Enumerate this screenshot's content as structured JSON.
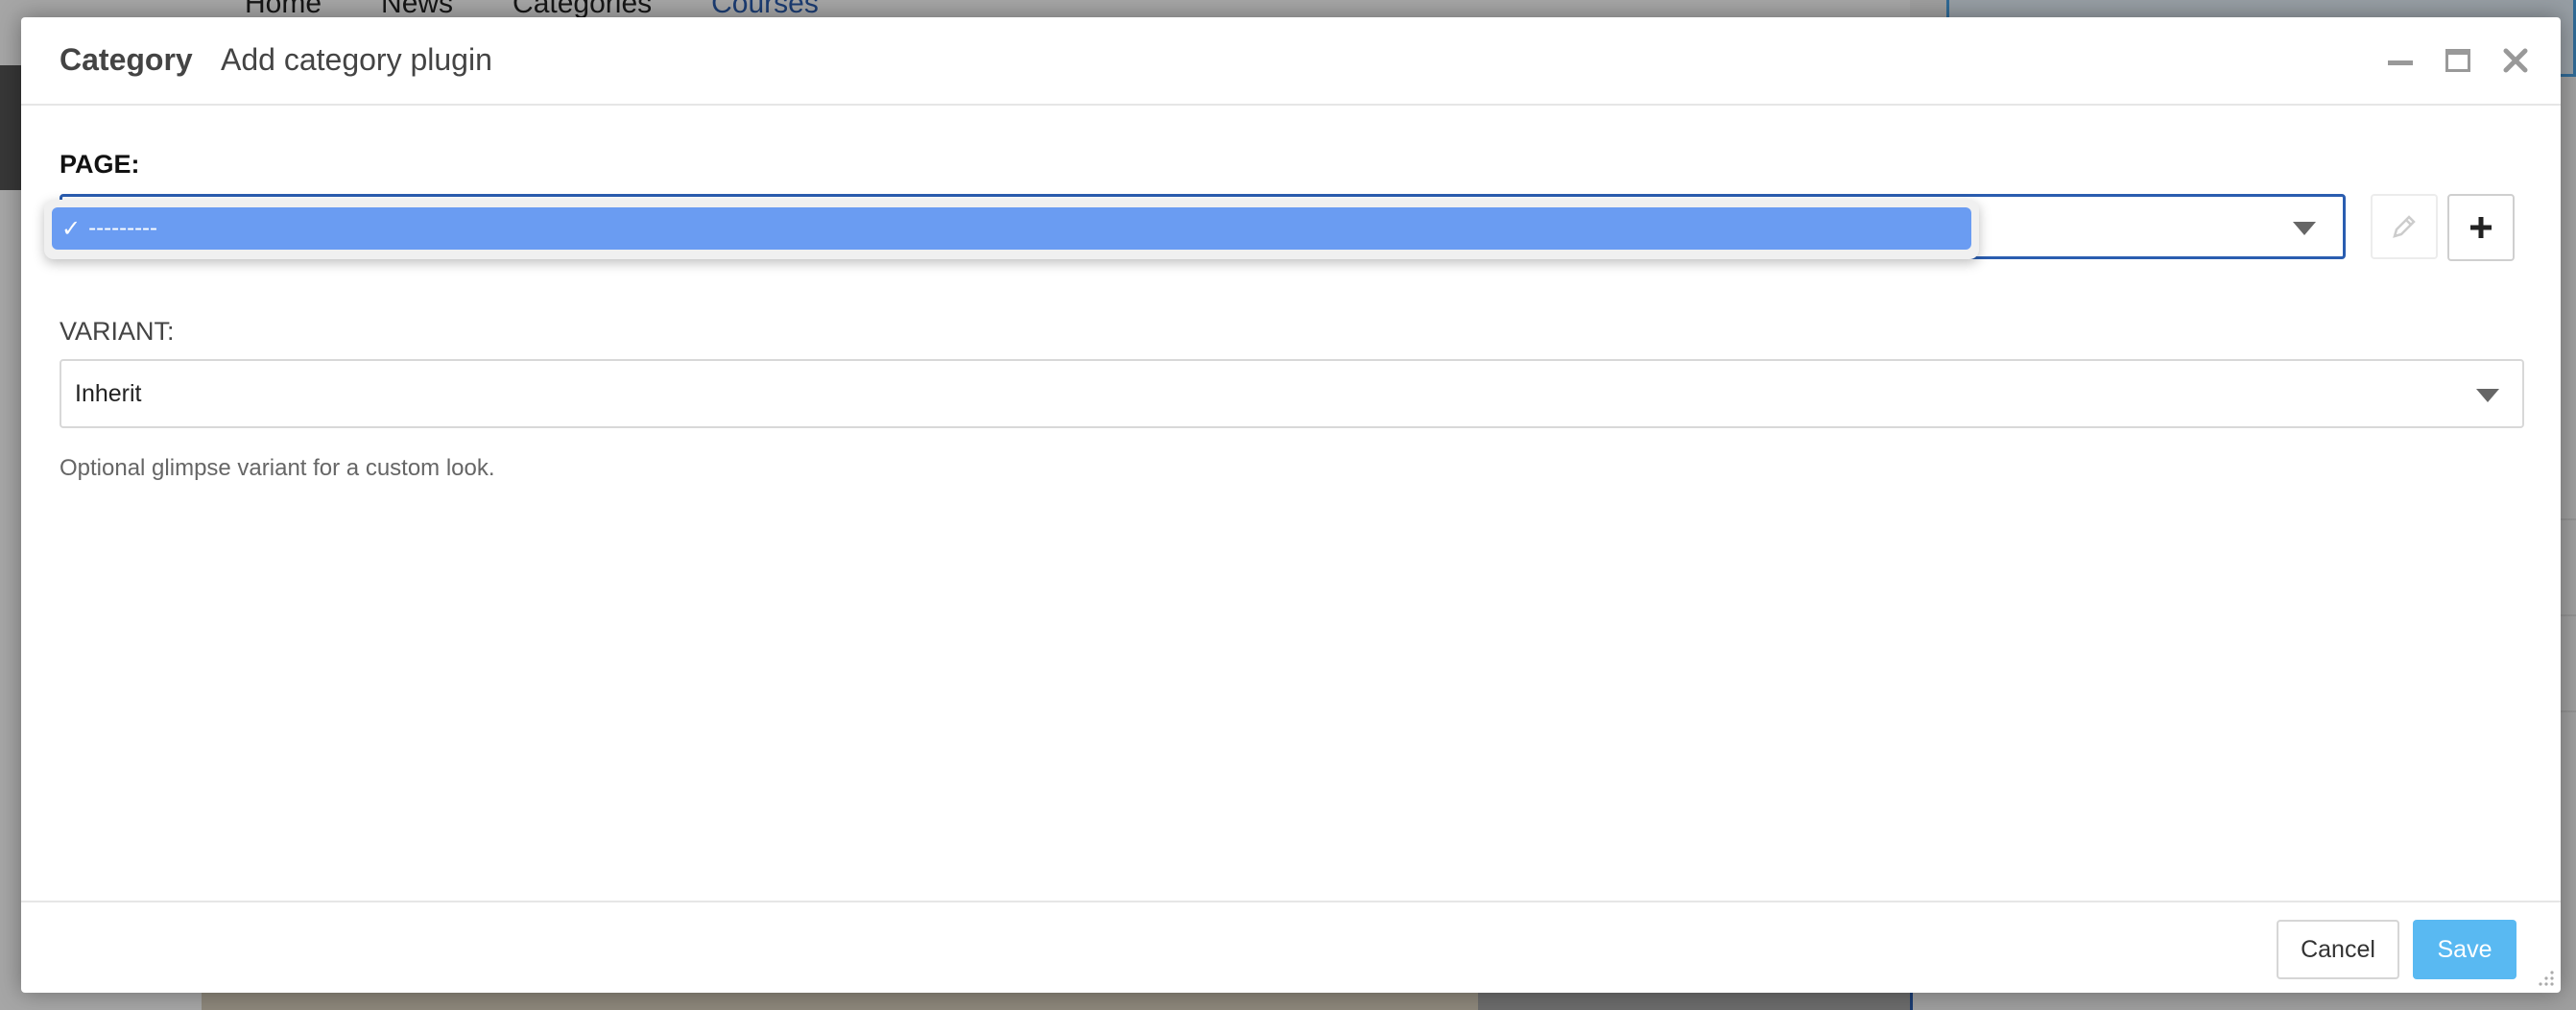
{
  "background": {
    "nav": [
      "Home",
      "News",
      "Categories",
      "Courses"
    ],
    "active_nav": "Courses"
  },
  "modal": {
    "title": "Category",
    "subtitle": "Add category plugin",
    "window_controls": [
      "minimize-icon",
      "maximize-icon",
      "close-icon"
    ]
  },
  "form": {
    "page": {
      "label": "PAGE:",
      "selected": "---------",
      "options": [
        "---------"
      ]
    },
    "variant": {
      "label": "VARIANT:",
      "selected": "Inherit",
      "help_text": "Optional glimpse variant for a custom look."
    }
  },
  "footer": {
    "cancel_label": "Cancel",
    "save_label": "Save"
  },
  "colors": {
    "accent": "#2a5db0",
    "save_button": "#59b9f2",
    "selected_option": "#6a9cf2"
  }
}
